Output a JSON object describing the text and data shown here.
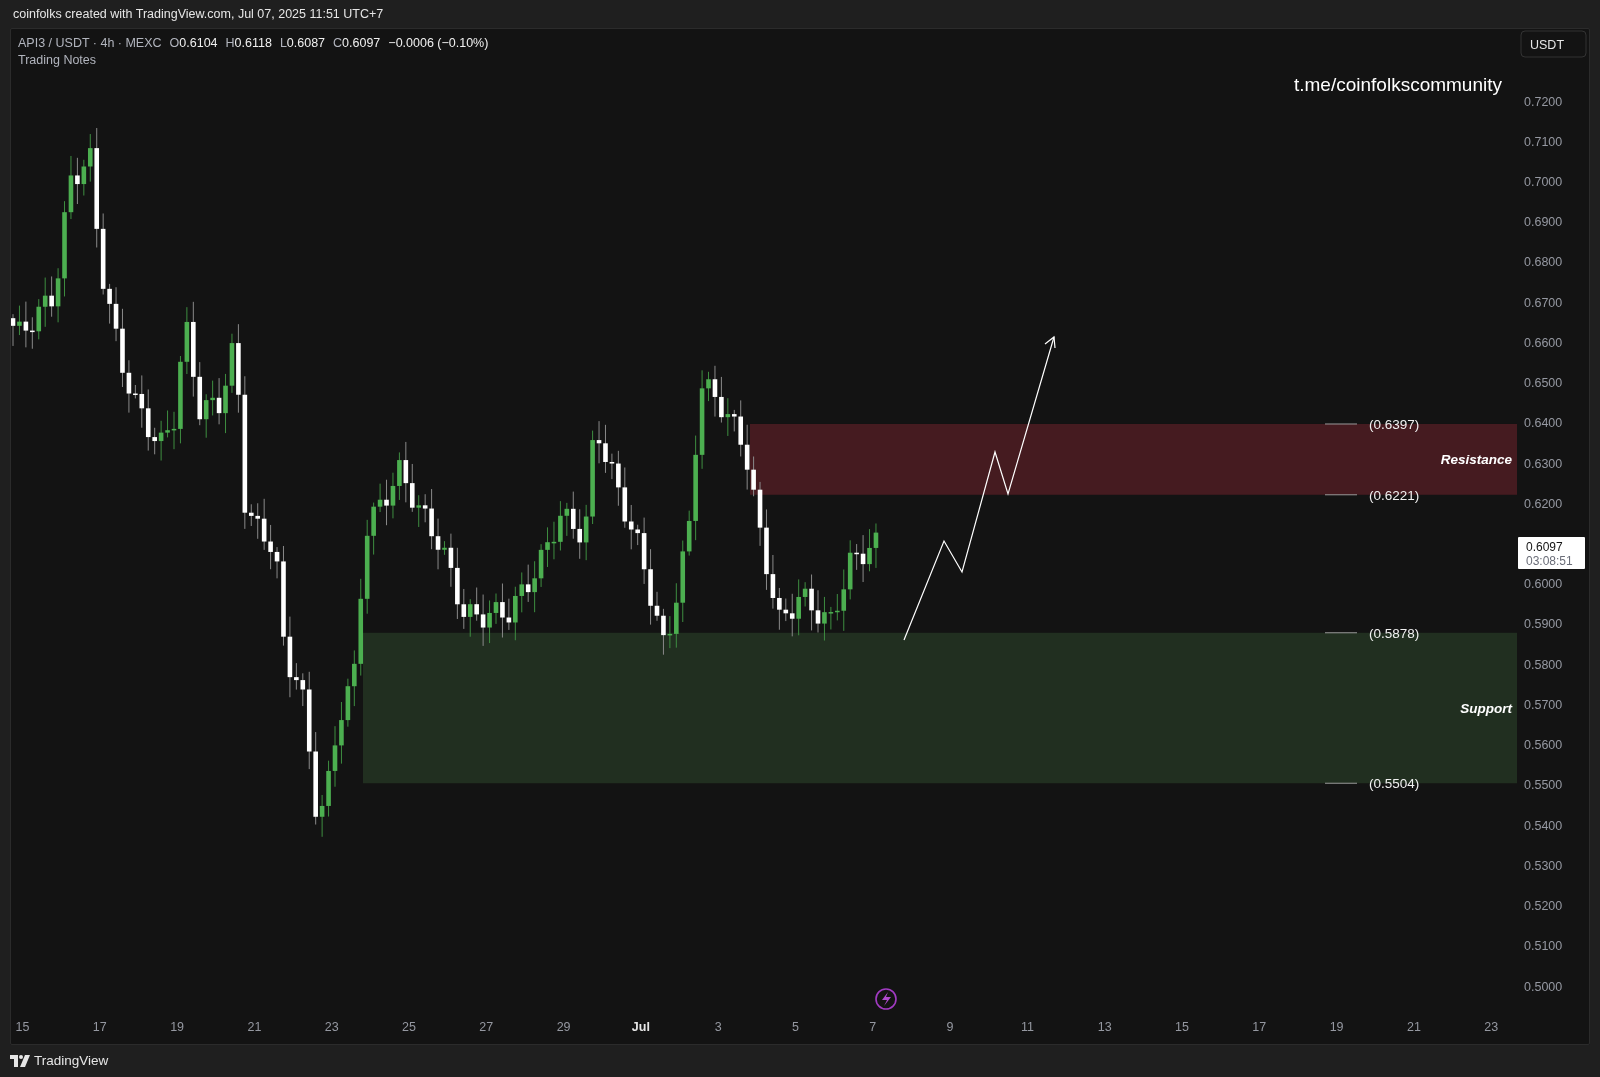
{
  "header": {
    "text": "coinfolks created with TradingView.com, Jul 07, 2025 11:51 UTC+7"
  },
  "legend": {
    "symbol": "API3 / USDT · 4h · MEXC",
    "ohlc": [
      {
        "key": "O",
        "value": "0.6104"
      },
      {
        "key": "H",
        "value": "0.6118"
      },
      {
        "key": "L",
        "value": "0.6087"
      },
      {
        "key": "C",
        "value": "0.6097"
      }
    ],
    "change": "−0.0006 (−0.10%)",
    "indicator": "Trading Notes"
  },
  "note": "t.me/coinfolkscommunity",
  "currency_button": "USDT",
  "zones": [
    {
      "label": "Resistance",
      "top": "(0.6397)",
      "bottom": "(0.6221)",
      "color": "#451b20"
    },
    {
      "label": "Support",
      "top": "(0.5878)",
      "bottom": "(0.5504)",
      "color": "#212f20"
    }
  ],
  "price_axis": {
    "labels": [
      "0.7200",
      "0.7100",
      "0.7000",
      "0.6900",
      "0.6800",
      "0.6700",
      "0.6600",
      "0.6500",
      "0.6400",
      "0.6300",
      "0.6200",
      "0.6000",
      "0.5900",
      "0.5800",
      "0.5700",
      "0.5600",
      "0.5500",
      "0.5400",
      "0.5300",
      "0.5200",
      "0.5100",
      "0.5000"
    ]
  },
  "last_price": {
    "price": "0.6097",
    "countdown": "03:08:51"
  },
  "time_axis": {
    "labels": [
      {
        "text": "15",
        "bold": false
      },
      {
        "text": "17",
        "bold": false
      },
      {
        "text": "19",
        "bold": false
      },
      {
        "text": "21",
        "bold": false
      },
      {
        "text": "23",
        "bold": false
      },
      {
        "text": "25",
        "bold": false
      },
      {
        "text": "27",
        "bold": false
      },
      {
        "text": "29",
        "bold": false
      },
      {
        "text": "Jul",
        "bold": true
      },
      {
        "text": "3",
        "bold": false
      },
      {
        "text": "5",
        "bold": false
      },
      {
        "text": "7",
        "bold": false
      },
      {
        "text": "9",
        "bold": false
      },
      {
        "text": "11",
        "bold": false
      },
      {
        "text": "13",
        "bold": false
      },
      {
        "text": "15",
        "bold": false
      },
      {
        "text": "17",
        "bold": false
      },
      {
        "text": "19",
        "bold": false
      },
      {
        "text": "21",
        "bold": false
      },
      {
        "text": "23",
        "bold": false
      }
    ]
  },
  "footer": {
    "brand": "TradingView"
  }
}
